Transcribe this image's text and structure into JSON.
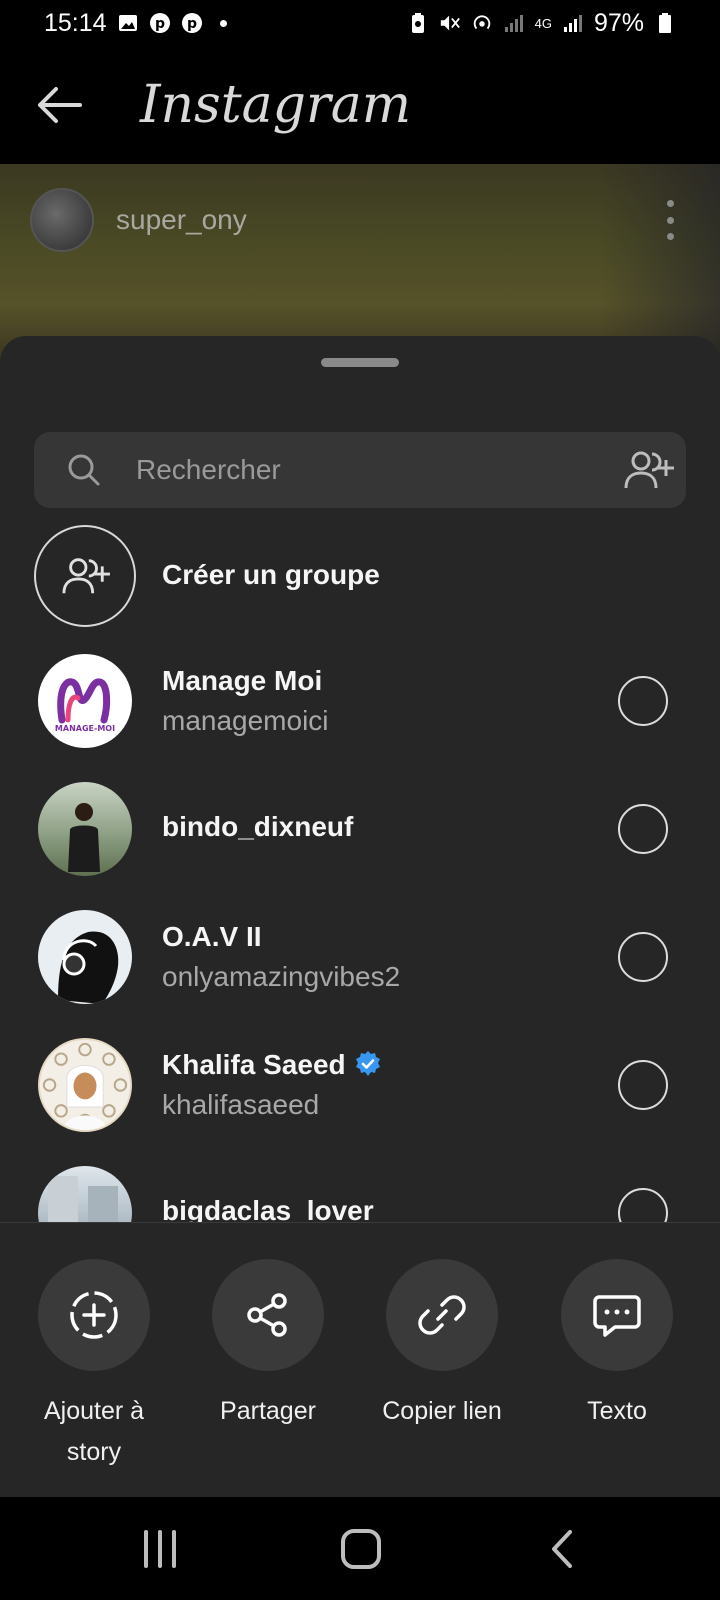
{
  "status_bar": {
    "time": "15:14",
    "battery": "97%",
    "network": "4G"
  },
  "header": {
    "title": "Instagram"
  },
  "post": {
    "owner": "super_ony"
  },
  "search": {
    "placeholder": "Rechercher"
  },
  "create_group": {
    "label": "Créer un groupe"
  },
  "contacts": [
    {
      "name": "Manage Moi",
      "username": "managemoici",
      "verified": false,
      "avatar_text": "MANAGE-MOI"
    },
    {
      "name": "bindo_dixneuf",
      "username": "",
      "verified": false
    },
    {
      "name": "O.A.V II",
      "username": "onlyamazingvibes2",
      "verified": false
    },
    {
      "name": "Khalifa Saeed",
      "username": "khalifasaeed",
      "verified": true
    },
    {
      "name": "bigdaclas_lover",
      "username": "",
      "verified": false
    }
  ],
  "actions": [
    {
      "label": "Ajouter à story",
      "icon": "add-story-icon"
    },
    {
      "label": "Partager",
      "icon": "share-icon"
    },
    {
      "label": "Copier lien",
      "icon": "link-icon"
    },
    {
      "label": "Texto",
      "icon": "message-icon"
    }
  ],
  "colors": {
    "sheet_bg": "#262626",
    "verified_blue": "#3897f0"
  }
}
